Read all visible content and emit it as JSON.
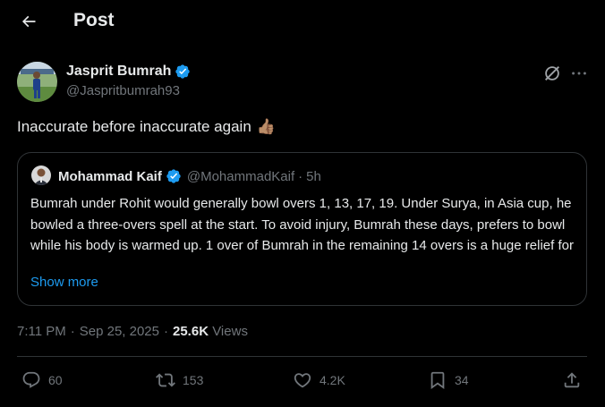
{
  "header": {
    "title": "Post"
  },
  "author": {
    "name": "Jasprit Bumrah",
    "handle": "@Jaspritbumrah93",
    "verified": true
  },
  "post": {
    "text": "Inaccurate before inaccurate again",
    "emoji": "👍🏽"
  },
  "quote": {
    "name": "Mohammad Kaif",
    "handle": "@MohammadKaif",
    "separator": "·",
    "time": "5h",
    "body": "Bumrah under Rohit would generally bowl overs 1, 13, 17, 19. Under Surya, in Asia cup, he bowled a three-overs spell at the start. To avoid injury, Bumrah these days, prefers to bowl while his body is warmed up. 1 over of Bumrah in the remaining 14 overs is a huge relief for",
    "show_more": "Show more"
  },
  "meta": {
    "time": "7:11 PM",
    "sep1": "·",
    "date": "Sep 25, 2025",
    "sep2": "·",
    "views_count": "25.6K",
    "views_label": "Views"
  },
  "actions": {
    "replies": "60",
    "reposts": "153",
    "likes": "4.2K",
    "bookmarks": "34"
  },
  "colors": {
    "background": "#000000",
    "text": "#e7e9ea",
    "muted": "#71767b",
    "accent": "#1d9bf0",
    "border": "#2f3336"
  },
  "icons": {
    "back": "arrow-left-icon",
    "verified": "verified-badge-icon",
    "grok": "grok-icon",
    "more": "more-horizontal-icon",
    "reply": "reply-bubble-icon",
    "repost": "repost-icon",
    "like": "heart-icon",
    "bookmark": "bookmark-icon",
    "share": "share-upload-icon"
  }
}
